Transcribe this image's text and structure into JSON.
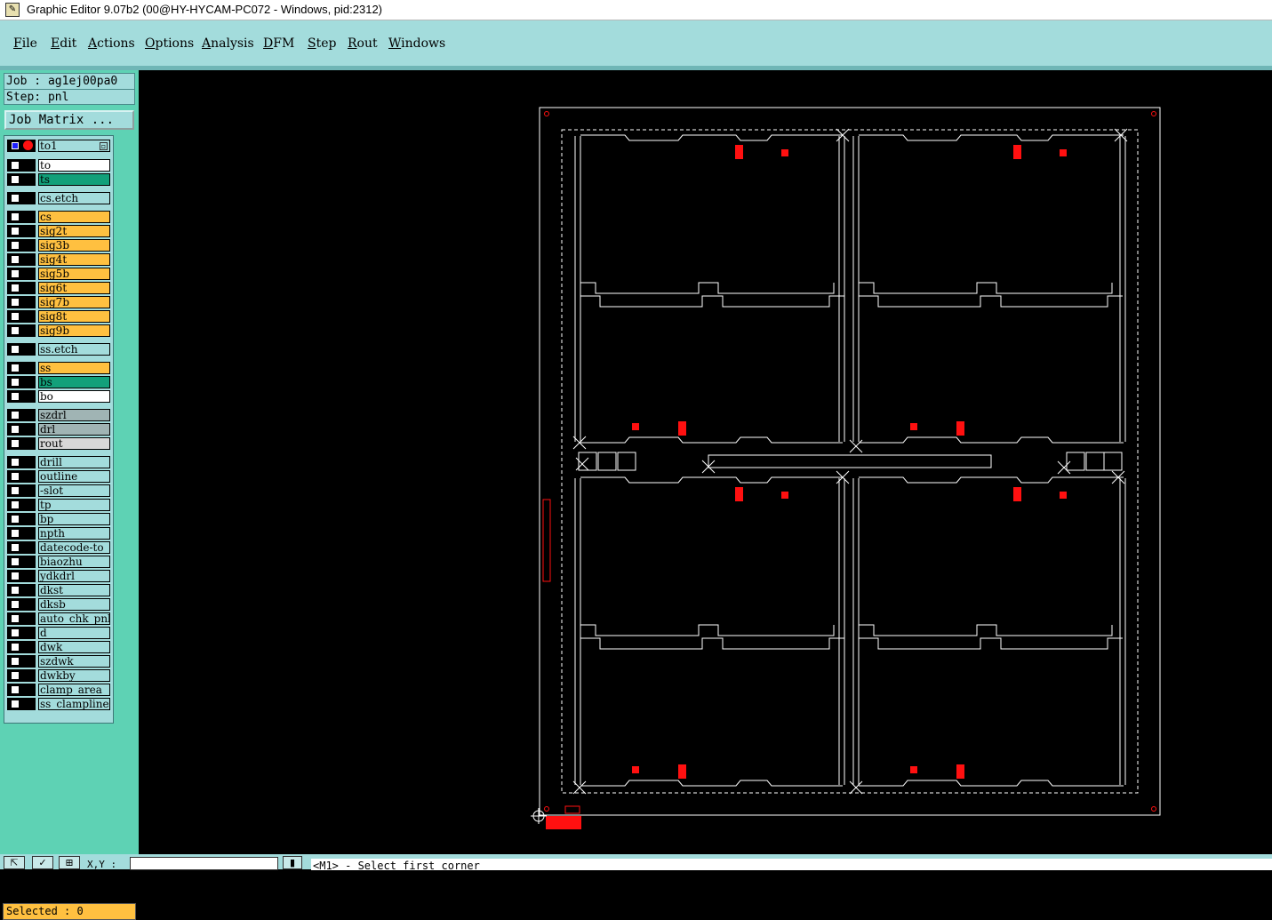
{
  "window": {
    "title": "Graphic Editor 9.07b2 (00@HY-HYCAM-PC072 - Windows, pid:2312)"
  },
  "menubar": {
    "items": [
      {
        "mnemonic": "F",
        "rest": "ile"
      },
      {
        "mnemonic": "E",
        "rest": "dit"
      },
      {
        "mnemonic": "A",
        "rest": "ctions"
      },
      {
        "mnemonic": "O",
        "rest": "ptions"
      },
      {
        "mnemonic": "A",
        "rest": "nalysis"
      },
      {
        "mnemonic": "D",
        "rest": "FM"
      },
      {
        "mnemonic": "S",
        "rest": "tep"
      },
      {
        "mnemonic": "R",
        "rest": "out"
      },
      {
        "mnemonic": "W",
        "rest": "indows"
      }
    ]
  },
  "job": {
    "job_line": "Job : ag1ej00pa0",
    "step_line": "Step: pnl",
    "matrix_button": "Job Matrix ..."
  },
  "layers": [
    {
      "name": "to1",
      "color": "#a3dcdc",
      "kind": "active"
    },
    {
      "name": "to",
      "color": "#ffffff"
    },
    {
      "name": "ts",
      "color": "#12a07a"
    },
    {
      "name": "cs.etch",
      "color": "#a3dcdc"
    },
    {
      "name": "cs",
      "color": "#ffc040"
    },
    {
      "name": "sig2t",
      "color": "#ffc040"
    },
    {
      "name": "sig3b",
      "color": "#ffc040"
    },
    {
      "name": "sig4t",
      "color": "#ffc040"
    },
    {
      "name": "sig5b",
      "color": "#ffc040"
    },
    {
      "name": "sig6t",
      "color": "#ffc040"
    },
    {
      "name": "sig7b",
      "color": "#ffc040"
    },
    {
      "name": "sig8t",
      "color": "#ffc040"
    },
    {
      "name": "sig9b",
      "color": "#ffc040"
    },
    {
      "name": "ss.etch",
      "color": "#a3dcdc"
    },
    {
      "name": "ss",
      "color": "#ffc040"
    },
    {
      "name": "bs",
      "color": "#12a07a"
    },
    {
      "name": "bo",
      "color": "#ffffff"
    },
    {
      "name": "szdrl",
      "color": "#a0b4b4"
    },
    {
      "name": "drl",
      "color": "#a0b4b4"
    },
    {
      "name": "rout",
      "color": "#d8d8d8"
    },
    {
      "name": "drill",
      "color": "#a3dcdc"
    },
    {
      "name": "outline",
      "color": "#a3dcdc"
    },
    {
      "name": "-slot",
      "color": "#a3dcdc"
    },
    {
      "name": "tp",
      "color": "#a3dcdc"
    },
    {
      "name": "bp",
      "color": "#a3dcdc"
    },
    {
      "name": "npth",
      "color": "#a3dcdc"
    },
    {
      "name": "datecode-to",
      "color": "#a3dcdc"
    },
    {
      "name": "biaozhu",
      "color": "#a3dcdc"
    },
    {
      "name": "ydkdrl",
      "color": "#a3dcdc"
    },
    {
      "name": "dkst",
      "color": "#a3dcdc"
    },
    {
      "name": "dksb",
      "color": "#a3dcdc"
    },
    {
      "name": "auto_chk_pnl",
      "color": "#a3dcdc"
    },
    {
      "name": "d",
      "color": "#a3dcdc"
    },
    {
      "name": "dwk",
      "color": "#a3dcdc"
    },
    {
      "name": "szdwk",
      "color": "#a3dcdc"
    },
    {
      "name": "dwkby",
      "color": "#a3dcdc"
    },
    {
      "name": "clamp_area",
      "color": "#a3dcdc"
    },
    {
      "name": "ss_clampline",
      "color": "#a3dcdc"
    }
  ],
  "status": {
    "selected": "Selected : 0",
    "xy_label": "X,Y :",
    "xy_value": "",
    "prompt": "<M1> - Select first corner"
  },
  "colors": {
    "panel_bg": "#5ed2b4",
    "menubar_bg": "#a3dcdc",
    "canvas_bg": "#000000",
    "feature_red": "#ff1010",
    "outline_white": "#ffffff"
  }
}
